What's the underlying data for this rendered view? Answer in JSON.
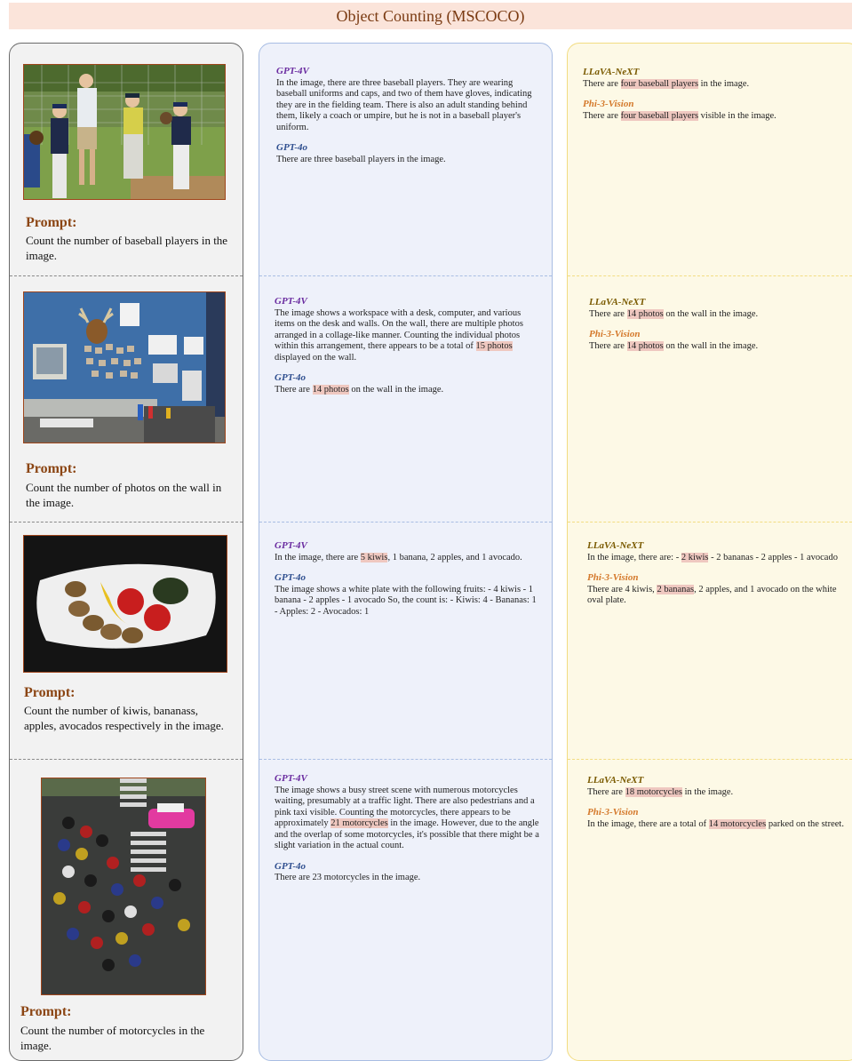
{
  "title": "Object Counting (MSCOCO)",
  "prompt_label": "Prompt:",
  "rows": [
    {
      "prompt": "Count the number of baseball players in the image.",
      "gpt4v": {
        "model": "GPT-4V",
        "pre": "In the image, there are three baseball players. They are wearing baseball uniforms and caps, and two of them have gloves, indicating they are in the fielding team. There is also an adult standing behind them, likely a coach or umpire, but he is not in a baseball player's uniform.",
        "hl": "",
        "post": ""
      },
      "gpt4o": {
        "model": "GPT-4o",
        "pre": "There are three baseball players in the image.",
        "hl": "",
        "post": ""
      },
      "llava": {
        "model": "LLaVA-NeXT",
        "pre": "There are ",
        "hl": "four baseball players",
        "post": " in the image."
      },
      "phi": {
        "model": "Phi-3-Vision",
        "pre": "There are ",
        "hl": "four baseball players",
        "post": " visible in the image."
      }
    },
    {
      "prompt": "Count the number of photos on the wall in the image.",
      "gpt4v": {
        "model": "GPT-4V",
        "pre": "The image shows a workspace with a desk, computer, and various items on the desk and walls. On the wall, there are multiple photos arranged in a collage-like manner. Counting the individual photos within this arrangement, there appears to be a total of ",
        "hl": "15 photos",
        "post": " displayed on the wall."
      },
      "gpt4o": {
        "model": "GPT-4o",
        "pre": "There are ",
        "hl": "14 photos",
        "post": " on the wall in the image."
      },
      "llava": {
        "model": "LLaVA-NeXT",
        "pre": "There are ",
        "hl": "14 photos",
        "post": " on the wall in the image."
      },
      "phi": {
        "model": "Phi-3-Vision",
        "pre": "There are ",
        "hl": "14 photos",
        "post": " on the wall in the image."
      }
    },
    {
      "prompt": "Count the number of kiwis, bananass, apples, avocados respectively in the image.",
      "gpt4v": {
        "model": "GPT-4V",
        "pre": "In the image, there are ",
        "hl": "5 kiwis",
        "post": ", 1 banana, 2 apples, and 1 avocado."
      },
      "gpt4o": {
        "model": "GPT-4o",
        "pre": "The image shows a white plate with the following fruits:  - 4 kiwis - 1 banana - 2 apples - 1 avocado  So, the count is: - Kiwis: 4 - Bananas: 1 - Apples: 2 - Avocados: 1",
        "hl": "",
        "post": ""
      },
      "llava": {
        "model": "LLaVA-NeXT",
        "pre": "In the image, there are:  - ",
        "hl": "2 kiwis",
        "post": " - 2 bananas - 2 apples - 1 avocado"
      },
      "phi": {
        "model": "Phi-3-Vision",
        "pre": "There are 4 kiwis, ",
        "hl": "2 bananas",
        "post": ", 2 apples, and 1 avocado on the white oval plate."
      }
    },
    {
      "prompt": "Count the number of motorcycles in the image.",
      "gpt4v": {
        "model": "GPT-4V",
        "pre": "The image shows a busy street scene with numerous motorcycles waiting, presumably at a traffic light. There are also pedestrians and a pink taxi visible. Counting the motorcycles, there appears to be approximately ",
        "hl": "21 motorcycles",
        "post": " in the image. However, due to the angle and the overlap of some motorcycles, it's possible that there might be a slight variation in the actual count."
      },
      "gpt4o": {
        "model": "GPT-4o",
        "pre": "There are 23 motorcycles in the image.",
        "hl": "",
        "post": ""
      },
      "llava": {
        "model": "LLaVA-NeXT",
        "pre": "There are ",
        "hl": "18 motorcycles",
        "post": " in the image."
      },
      "phi": {
        "model": "Phi-3-Vision",
        "pre": "In the image, there are a total of ",
        "hl": "14 motorcycles",
        "post": " parked on the street."
      }
    }
  ]
}
